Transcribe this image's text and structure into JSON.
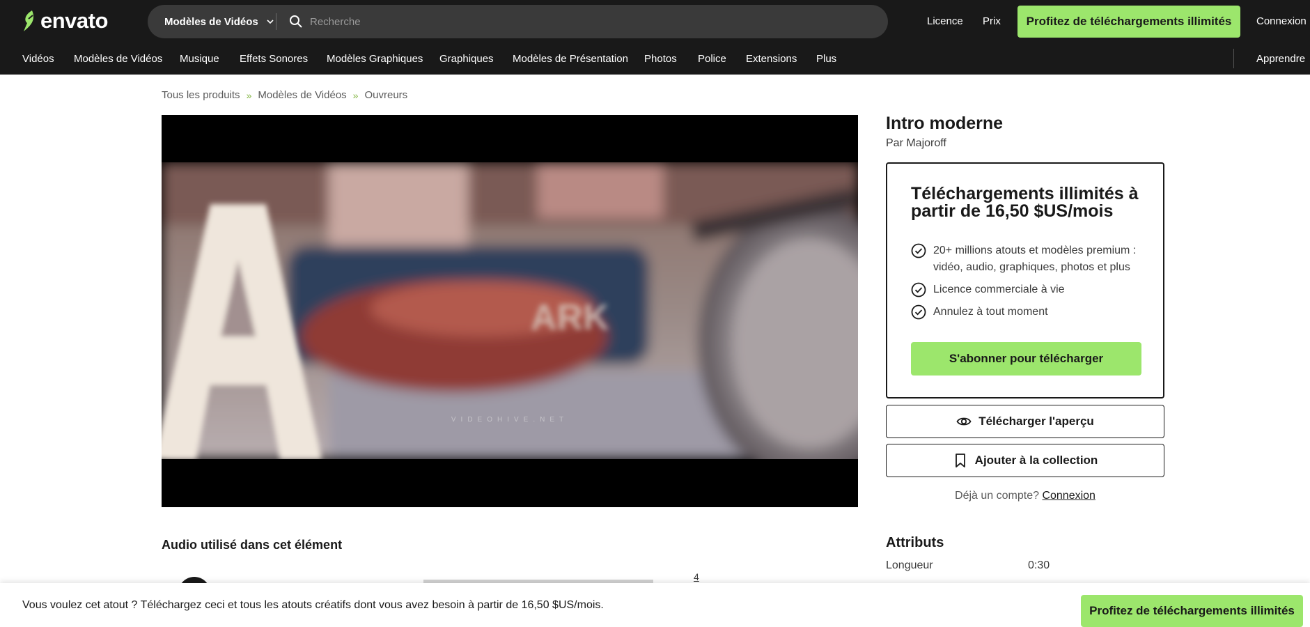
{
  "header": {
    "logo_text": "envato",
    "category_select": "Modèles de Vidéos",
    "search_placeholder": "Recherche",
    "links": [
      "Licence",
      "Prix"
    ],
    "cta": "Profitez de téléchargements illimités",
    "signin": "Connexion"
  },
  "nav": {
    "items": [
      "Vidéos",
      "Modèles de Vidéos",
      "Musique",
      "Effets Sonores",
      "Modèles Graphiques",
      "Graphiques",
      "Modèles de Présentation",
      "Photos",
      "Police",
      "Extensions",
      "Plus"
    ],
    "learn": "Apprendre"
  },
  "breadcrumb": [
    "Tous les produits",
    "Modèles de Vidéos",
    "Ouvreurs"
  ],
  "breadcrumb_separator": "»",
  "video": {
    "watermark": "VIDEOHIVE.NET",
    "overlay_letters": "ARK"
  },
  "product": {
    "title": "Intro moderne",
    "author": "Par Majoroff"
  },
  "pricing": {
    "title": "Téléchargements illimités à partir de 16,50 $US/mois",
    "features": [
      "20+ millions atouts et modèles premium : vidéo, audio, graphiques, photos et plus",
      "Licence commerciale à vie",
      "Annulez à tout moment"
    ],
    "subscribe": "S'abonner pour télécharger"
  },
  "actions": {
    "preview": "Télécharger l'aperçu",
    "collection": "Ajouter à la collection"
  },
  "account": {
    "question": "Déjà un compte?",
    "link": "Connexion"
  },
  "attributes": {
    "title": "Attributs",
    "rows": [
      {
        "key": "Longueur",
        "value": "0:30"
      }
    ]
  },
  "audio": {
    "title": "Audio utilisé dans cet élément",
    "count": "4"
  },
  "banner": {
    "text": "Vous voulez cet atout ? Téléchargez ceci et tous les atouts créatifs dont vous avez besoin à partir de 16,50 $US/mois.",
    "cta": "Profitez de téléchargements illimités"
  },
  "colors": {
    "header_bg": "#191919",
    "accent_green": "#9ce66c",
    "breadcrumb_separator": "#82b541"
  }
}
